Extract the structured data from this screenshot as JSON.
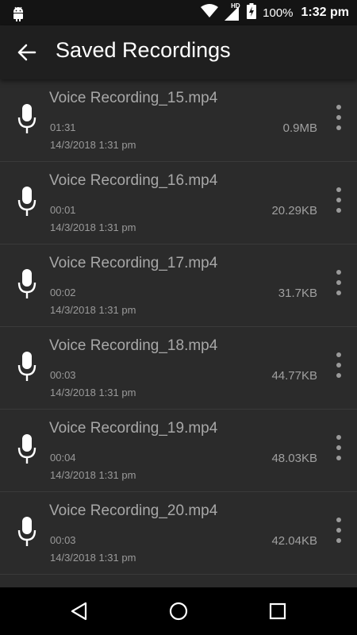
{
  "status_bar": {
    "hd_label": "HD",
    "battery_percent": "100%",
    "time": "1:32 pm"
  },
  "header": {
    "title": "Saved Recordings",
    "back_icon": "arrow-back-icon"
  },
  "recordings": [
    {
      "name": "Voice Recording_15.mp4",
      "duration": "01:31",
      "date": "14/3/2018 1:31 pm",
      "size": "0.9MB"
    },
    {
      "name": "Voice Recording_16.mp4",
      "duration": "00:01",
      "date": "14/3/2018 1:31 pm",
      "size": "20.29KB"
    },
    {
      "name": "Voice Recording_17.mp4",
      "duration": "00:02",
      "date": "14/3/2018 1:31 pm",
      "size": "31.7KB"
    },
    {
      "name": "Voice Recording_18.mp4",
      "duration": "00:03",
      "date": "14/3/2018 1:31 pm",
      "size": "44.77KB"
    },
    {
      "name": "Voice Recording_19.mp4",
      "duration": "00:04",
      "date": "14/3/2018 1:31 pm",
      "size": "48.03KB"
    },
    {
      "name": "Voice Recording_20.mp4",
      "duration": "00:03",
      "date": "14/3/2018 1:31 pm",
      "size": "42.04KB"
    }
  ],
  "icons": {
    "list_item": "microphone-icon",
    "overflow": "more-vert-icon",
    "nav_back": "nav-back-icon",
    "nav_home": "nav-home-icon",
    "nav_recents": "nav-recents-icon"
  },
  "colors": {
    "background": "#2b2b2b",
    "app_bar": "#1f1f1f",
    "status_bar": "#141414",
    "nav_bar": "#000000",
    "secondary_text": "#a8a8a8"
  }
}
